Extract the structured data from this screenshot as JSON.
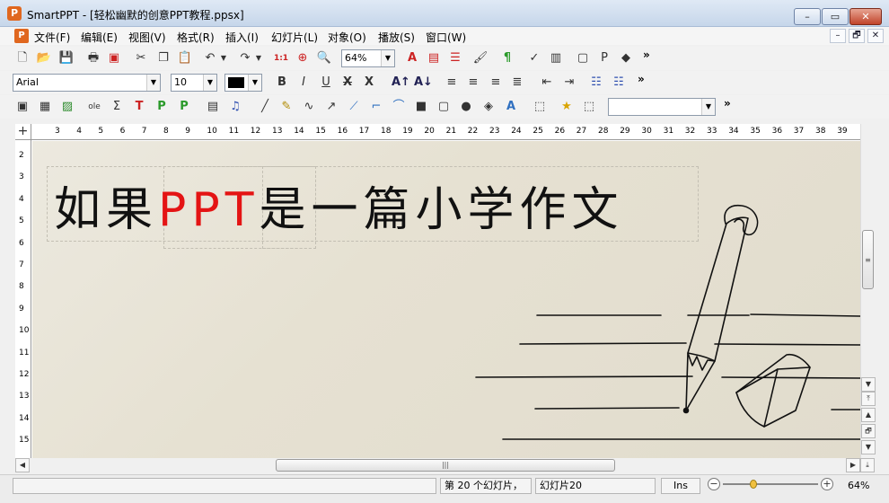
{
  "window": {
    "title": "SmartPPT - [轻松幽默的创意PPT教程.ppsx]",
    "app_icon": "P",
    "controls": {
      "minimize": "–",
      "restore": "▭",
      "close": "✕"
    }
  },
  "menubar": {
    "items": [
      "文件(F)",
      "编辑(E)",
      "视图(V)",
      "格式(R)",
      "插入(I)",
      "幻灯片(L)",
      "对象(O)",
      "播放(S)",
      "窗口(W)"
    ],
    "doc_controls": {
      "minimize": "–",
      "restore": "🗗",
      "close": "✕"
    }
  },
  "toolbar1": {
    "zoom_value": "64%",
    "more": "»"
  },
  "toolbar2": {
    "font_name": "Arial",
    "font_size": "10",
    "text_color": "#000000",
    "more": "»"
  },
  "toolbar3": {
    "style_value": "",
    "more": "»"
  },
  "ruler": {
    "h_ticks": [
      "3",
      "4",
      "5",
      "6",
      "7",
      "8",
      "9",
      "10",
      "11",
      "12",
      "13",
      "14",
      "15",
      "16",
      "17",
      "18",
      "19",
      "20",
      "21",
      "22",
      "23",
      "24",
      "25",
      "26",
      "27",
      "28",
      "29",
      "30",
      "31",
      "32",
      "33",
      "34",
      "35",
      "36",
      "37",
      "38",
      "39"
    ],
    "v_ticks": [
      "2",
      "3",
      "4",
      "5",
      "6",
      "7",
      "8",
      "9",
      "10",
      "11",
      "12",
      "13",
      "14",
      "15"
    ]
  },
  "slide": {
    "title_part1": "如果",
    "title_highlight": "PPT",
    "title_part2": "是一篇小学作文",
    "highlight_color": "#e41414"
  },
  "statusbar": {
    "slide_position": "第 20 个幻灯片，",
    "slide_name": "幻灯片20",
    "mode": "Ins",
    "zoom": "64%",
    "zoom_level": 0.64
  }
}
